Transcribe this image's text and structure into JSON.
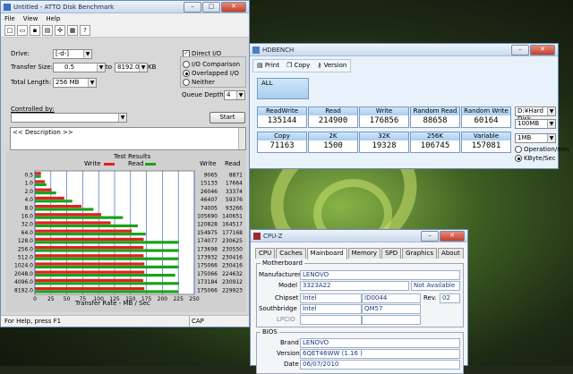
{
  "atto": {
    "title": "Untitled - ATTO Disk Benchmark",
    "menu": [
      "File",
      "View",
      "Help"
    ],
    "drive_label": "Drive:",
    "drive_value": "[-d-]",
    "transfer_size_label": "Transfer Size:",
    "transfer_from": "0.5",
    "to_label": "to",
    "transfer_to": "8192.0",
    "kb_label": "KB",
    "total_length_label": "Total Length:",
    "total_length_value": "256 MB",
    "direct_io": "Direct I/O",
    "io_comparison": "I/O Comparison",
    "overlapped_io": "Overlapped I/O",
    "neither": "Neither",
    "queue_depth_label": "Queue Depth:",
    "queue_depth_value": "4",
    "controlled_by_label": "Controlled by:",
    "start_button": "Start",
    "description": "<< Description >>",
    "results_title": "Test Results",
    "write_legend": "Write",
    "read_legend": "Read",
    "write_col": "Write",
    "read_col": "Read",
    "x_axis_label": "Transfer Rate - MB / Sec",
    "status_text": "For Help, press F1",
    "status_cap": "CAP"
  },
  "chart_data": {
    "type": "bar",
    "title": "Test Results",
    "xlabel": "Transfer Rate - MB / Sec",
    "ylabel": "",
    "xlim": [
      0,
      250
    ],
    "x_ticks": [
      "0",
      "25",
      "50",
      "75",
      "100",
      "125",
      "150",
      "175",
      "200",
      "225",
      "250"
    ],
    "categories": [
      "0.5",
      "1.0",
      "2.0",
      "4.0",
      "8.0",
      "16.0",
      "32.0",
      "64.0",
      "128.0",
      "256.0",
      "512.0",
      "1024.0",
      "2048.0",
      "4096.0",
      "8192.0"
    ],
    "series": [
      {
        "name": "Write",
        "color": "#e02020",
        "values": [
          9065,
          15133,
          26046,
          46407,
          74005,
          105690,
          120828,
          154975,
          174077,
          173698,
          173932,
          175066,
          175066,
          173184,
          175066
        ]
      },
      {
        "name": "Read",
        "color": "#1aa21a",
        "values": [
          8871,
          17664,
          33374,
          59376,
          93266,
          140651,
          164517,
          177168,
          230625,
          230550,
          230416,
          230416,
          224632,
          230912,
          229923
        ]
      }
    ]
  },
  "hdbench": {
    "title": "HDBENCH",
    "print": "Print",
    "copy": "Copy",
    "version": "Version",
    "all_label": "ALL",
    "row1": [
      {
        "label": "ReadWrite",
        "value": "135144"
      },
      {
        "label": "Read",
        "value": "214900"
      },
      {
        "label": "Write",
        "value": "176856"
      },
      {
        "label": "Random Read",
        "value": "88658"
      },
      {
        "label": "Random Write",
        "value": "60164"
      }
    ],
    "row2": [
      {
        "label": "Copy",
        "value": "71163"
      },
      {
        "label": "2K",
        "value": "1500"
      },
      {
        "label": "32K",
        "value": "19328"
      },
      {
        "label": "256K",
        "value": "106745"
      },
      {
        "label": "Variable",
        "value": "157081"
      }
    ],
    "disk_select": "D:¥Hard Disk",
    "size_select_1": "100MB",
    "size_select_2": "1MB",
    "unit_ops": "Operation/min",
    "unit_kbs": "KByte/Sec"
  },
  "cpuz": {
    "title": "CPU-Z",
    "tabs": [
      "CPU",
      "Caches",
      "Mainboard",
      "Memory",
      "SPD",
      "Graphics",
      "About"
    ],
    "active_tab": "Mainboard",
    "mb_group": "Motherboard",
    "manufacturer_label": "Manufacturer",
    "manufacturer_value": "LENOVO",
    "model_label": "Model",
    "model_value": "3323A22",
    "model_extra": "Not Available",
    "chipset_label": "Chipset",
    "chipset_vendor": "Intel",
    "chipset_value": "ID0044",
    "rev_label": "Rev.",
    "rev_value": "02",
    "southbridge_label": "Southbridge",
    "southbridge_vendor": "Intel",
    "southbridge_value": "QM57",
    "lpcio_label": "LPCIO",
    "bios_group": "BIOS",
    "brand_label": "Brand",
    "brand_value": "LENOVO",
    "version_label": "Version",
    "version_value": "6QET46WW (1.16 )",
    "date_label": "Date",
    "date_value": "06/07/2010"
  }
}
